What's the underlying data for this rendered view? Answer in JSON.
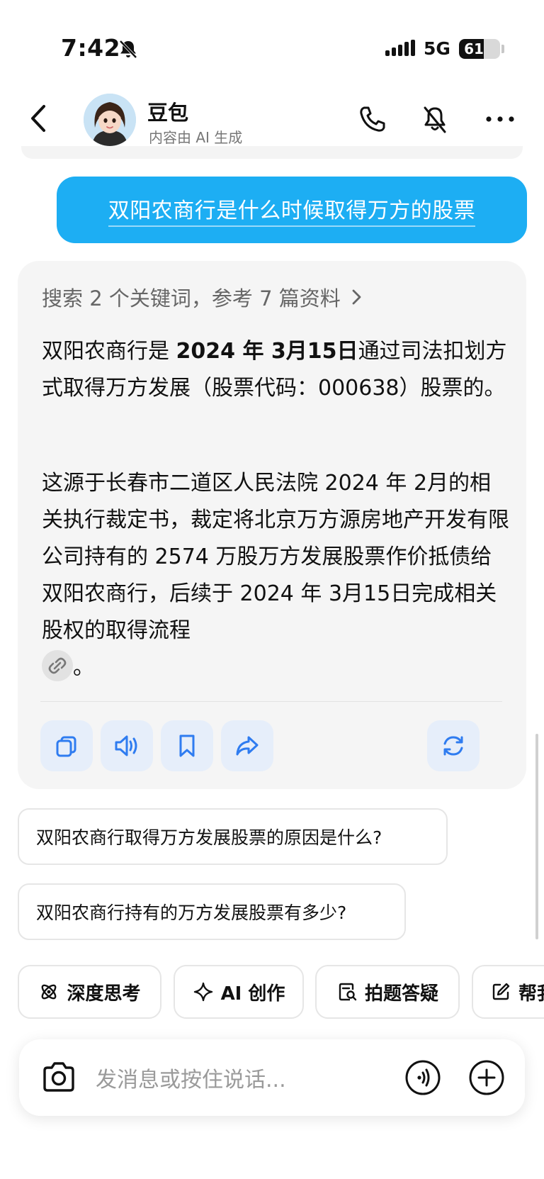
{
  "status_bar": {
    "time": "7:42",
    "network": "5G",
    "battery": "61",
    "battery_level": 0.61
  },
  "header": {
    "name": "豆包",
    "subtitle": "内容由 AI 生成"
  },
  "user_message": "双阳农商行是什么时候取得万方的股票",
  "answer": {
    "search_ref": "搜索 2 个关键词，参考 7 篇资料",
    "p1_part1": "双阳农商行是 ",
    "p1_bold": "2024 年 3月15日",
    "p1_part2": "通过司法扣划方式取得万方发展（股票代码：000638）股票的。",
    "p2_text": "这源于长春市二道区人民法院 2024 年 2月的相关执行裁定书，裁定将北京万方源房地产开发有限公司持有的 2574 万股万方发展股票作价抵债给双阳农商行，后续于 2024 年 3月15日完成相关股权的取得流程",
    "p2_end": "。"
  },
  "suggestions": [
    "双阳农商行取得万方发展股票的原因是什么?",
    "双阳农商行持有的万方发展股票有多少?"
  ],
  "tools": [
    "深度思考",
    "AI 创作",
    "拍题答疑",
    "帮我"
  ],
  "input": {
    "placeholder": "发消息或按住说话..."
  },
  "colors": {
    "accent": "#1daef3",
    "icon_blue": "#2f7cf0"
  }
}
